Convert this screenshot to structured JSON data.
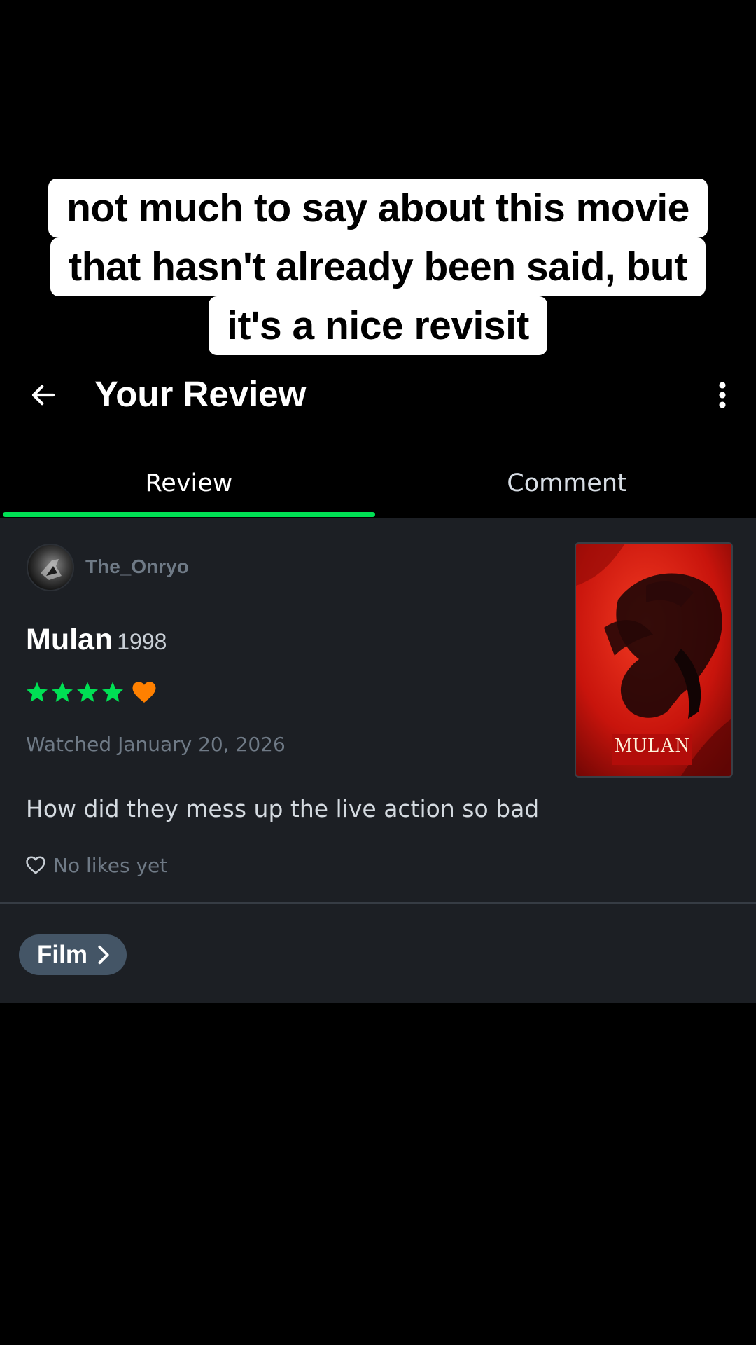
{
  "caption": {
    "lines": [
      "not much to say about this movie",
      "that hasn't already been said, but",
      "it's a nice revisit"
    ]
  },
  "header": {
    "title": "Your Review",
    "back_icon": "arrow-left-icon",
    "menu_icon": "more-vertical-icon"
  },
  "tabs": [
    {
      "label": "Review",
      "active": true
    },
    {
      "label": "Comment",
      "active": false
    }
  ],
  "review": {
    "username": "The_Onryo",
    "film_title": "Mulan",
    "film_year": "1998",
    "rating_stars": 4,
    "rating_max": 5,
    "liked": true,
    "watched": "Watched January 20, 2026",
    "text": "How did they mess up the live action so bad",
    "likes_text": "No likes yet"
  },
  "poster": {
    "label": "MULAN"
  },
  "film_link": {
    "label": "Film"
  },
  "colors": {
    "accent_green": "#00e054",
    "like_orange": "#ff8000",
    "card_bg": "#1c1f24",
    "pill_bg": "#445566",
    "muted_text": "#6f7a86"
  }
}
